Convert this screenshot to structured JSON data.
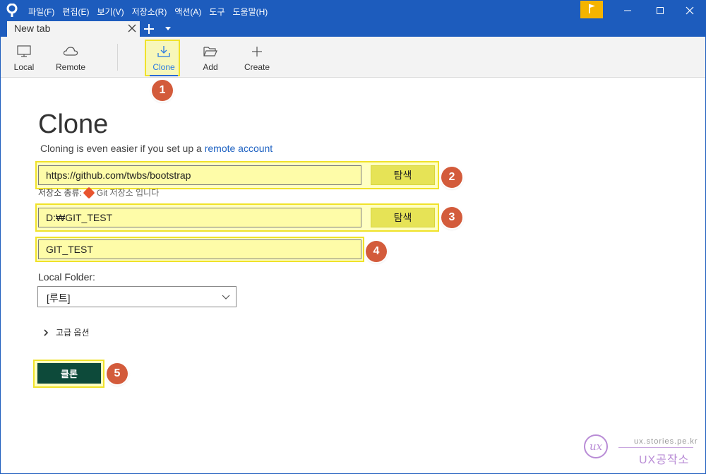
{
  "titlebar": {
    "menu": [
      "파일(F)",
      "편집(E)",
      "보기(V)",
      "저장소(R)",
      "액션(A)",
      "도구",
      "도움말(H)"
    ]
  },
  "tabs": [
    {
      "label": "New tab"
    }
  ],
  "toolbar": {
    "local": "Local",
    "remote": "Remote",
    "clone": "Clone",
    "add": "Add",
    "create": "Create"
  },
  "main": {
    "title": "Clone",
    "subtitle_prefix": "Cloning is even easier if you set up a",
    "subtitle_link": "remote account",
    "source_url": "https://github.com/twbs/bootstrap",
    "browse_label": "탐색",
    "repo_type_label": "저장소 종류:",
    "repo_type_value": "Git 저장소 입니다",
    "dest_path": "D:₩GIT_TEST",
    "name": "GIT_TEST",
    "local_folder_label": "Local Folder:",
    "local_folder_value": "[루트]",
    "advanced_label": "고급 옵션",
    "clone_button": "클론"
  },
  "annotations": [
    "1",
    "2",
    "3",
    "4",
    "5"
  ],
  "watermark": {
    "logo_text": "ux",
    "url": "ux.stories.pe.kr",
    "name": "UX공작소"
  },
  "colors": {
    "titlebar": "#1d5cbd",
    "highlight": "#fefca8",
    "badge": "#d35b3b",
    "clone_button": "#0d4a3a",
    "flag": "#f5b400"
  }
}
